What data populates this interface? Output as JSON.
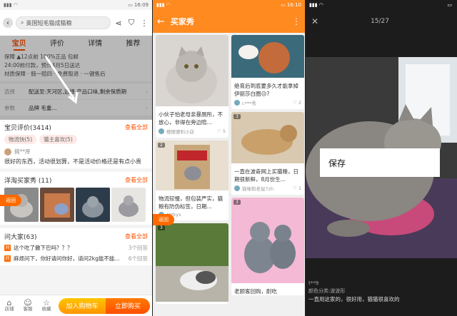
{
  "status": {
    "p1_time": "16:09",
    "p2_time": "16:10",
    "p3_time": ""
  },
  "product": {
    "search_text": "英国短毛猫成猫粮",
    "tabs": [
      "宝贝",
      "评价",
      "详情",
      "推荐"
    ],
    "info_line1": "保障  ▲12点前  100%正品  包邮",
    "info_line2": "24:00前付款，预计4月5日送达",
    "info_line3": "材质保障 · 假一赔四 · 免费取退 · 一键售后",
    "options": [
      {
        "key": "选择",
        "value": "配送至:天河区,选择 产品口味,剩余保质期"
      },
      {
        "key": "参数",
        "value": "品牌 毛重..."
      }
    ],
    "reviews": {
      "title": "宝贝评价(3414)",
      "more": "查看全部",
      "tags": [
        "物流快(5)",
        "猫主喜欢(5)"
      ],
      "user": "搞**庠",
      "text": "很好的东西，活动很划算，不是活动价格还是有点小贵"
    },
    "show": {
      "title": "洋淘买家秀 (11)",
      "more": "查看全部",
      "back": "返回"
    },
    "qa": {
      "title": "问大家(63)",
      "more": "查看全部",
      "items": [
        {
          "q": "这个吃了撒下巴吗？？？",
          "count": "3个回答"
        },
        {
          "q": "麻烦问下，你好请问你好，请问2kg能不能...",
          "count": "6个回答"
        }
      ]
    },
    "bottom": {
      "shop": "店铺",
      "service": "客服",
      "fav": "收藏",
      "cart": "加入购物车",
      "buy": "立即购买"
    }
  },
  "buyer_show": {
    "title": "买家秀",
    "back": "返回",
    "left": [
      {
        "badge": "",
        "text": "小伙子怕老母亲暴厕所，不放心，非得在旁边陪...",
        "user": "檀檀便利小店",
        "likes": "5"
      },
      {
        "badge": "2",
        "text": "物流较慢，但包装严实，猫粮有防伪标签，日期...",
        "user": "***kys",
        "likes": ""
      },
      {
        "badge": "3",
        "text": "",
        "user": "",
        "likes": ""
      }
    ],
    "right": [
      {
        "badge": "",
        "text": "绝育后到底要多久才能拿掉伊丽莎白圈😥?",
        "user": "c***秀",
        "likes": "2"
      },
      {
        "badge": "3",
        "text": "一直在波奇网上买猫粮，日期很新鲜，8月份生...",
        "user": "猫咪和老鼠7zh",
        "likes": "1"
      },
      {
        "badge": "3",
        "text": "老顾客回购，耐吃",
        "user": "",
        "likes": ""
      }
    ]
  },
  "viewer": {
    "counter": "15/27",
    "save": "保存",
    "user": "t**9",
    "category": "颜色分类:波波形",
    "text": "一直用这家的，很好用，猫猫很喜欢的"
  },
  "colors": {
    "accent": "#ff5000",
    "header_orange": "#ff8a20"
  }
}
